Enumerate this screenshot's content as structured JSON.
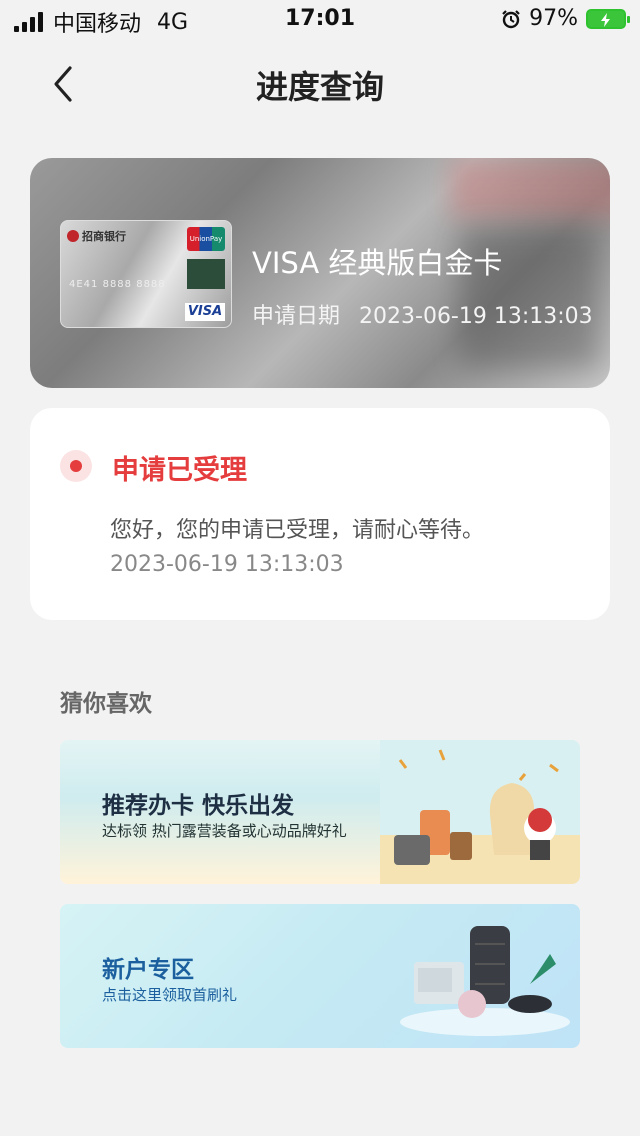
{
  "status_bar": {
    "carrier": "中国移动",
    "network": "4G",
    "time": "17:01",
    "battery": "97%"
  },
  "nav": {
    "title": "进度查询",
    "back_icon": "chevron-left-icon"
  },
  "card": {
    "name": "VISA 经典版白金卡",
    "date_label": "申请日期",
    "date_value": "2023-06-19 13:13:03"
  },
  "progress": {
    "title": "申请已受理",
    "message": "您好，您的申请已受理，请耐心等待。",
    "time": "2023-06-19 13:13:03",
    "accent": "#e53d3d"
  },
  "recommend": {
    "title": "猜你喜欢",
    "banners": [
      {
        "title": "推荐办卡  快乐出发",
        "subtitle": "达标领 热门露营装备或心动品牌好礼"
      },
      {
        "title": "新户专区",
        "subtitle": "点击这里领取首刷礼"
      }
    ]
  }
}
